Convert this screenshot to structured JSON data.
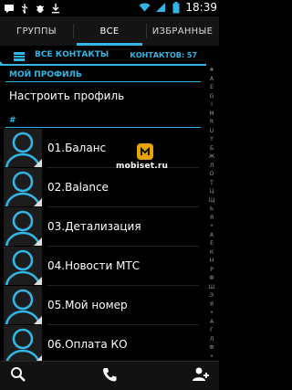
{
  "status_bar": {
    "time": "18:39",
    "left_icons": [
      "messaging-icon",
      "usb-icon",
      "bug-icon",
      "download-icon"
    ],
    "right_icons": [
      "wifi-icon",
      "signal-icon",
      "battery-icon"
    ]
  },
  "tabs": [
    {
      "label": "ГРУППЫ",
      "active": false
    },
    {
      "label": "ВСЕ",
      "active": true
    },
    {
      "label": "ИЗБРАННЫЕ",
      "active": false
    }
  ],
  "filter": {
    "label": "ВСЕ КОНТАКТЫ",
    "count": "КОНТАКТОВ: 57"
  },
  "profile_section": {
    "header": "МОЙ ПРОФИЛЬ",
    "item": "Настроить профиль"
  },
  "contacts_section": {
    "header": "#"
  },
  "contacts": [
    {
      "name": "01.Баланс"
    },
    {
      "name": "02.Balance"
    },
    {
      "name": "03.Детализация"
    },
    {
      "name": "04.Новости МТС"
    },
    {
      "name": "05.Мой номер"
    },
    {
      "name": "06.Оплата КО"
    }
  ],
  "index_letters": [
    "#",
    "A",
    "E",
    "G",
    "I",
    "M",
    "R",
    "U",
    "Y",
    "Б",
    "Ж",
    "Л",
    "О",
    "Т",
    "Ц",
    "Щ",
    "Ь",
    "Я",
    "•",
    "А",
    "Е",
    "К",
    "Н",
    "Р",
    "Ф",
    "Ш",
    "Э",
    "Я",
    "•",
    "А",
    "Г",
    "Л",
    "Ф",
    "•"
  ],
  "watermark": {
    "text": "mobiset.ru"
  },
  "colors": {
    "accent": "#33b5e5",
    "background": "#000000"
  }
}
